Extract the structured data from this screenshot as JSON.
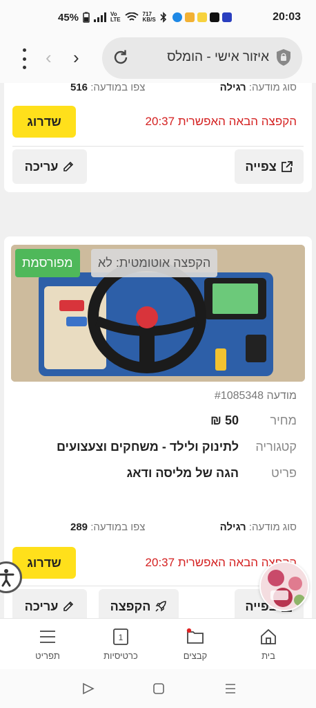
{
  "status_bar": {
    "battery": "45%",
    "network_speed_value": "717",
    "network_speed_unit": "KB/S",
    "time": "20:03"
  },
  "browser": {
    "url_title": "איזור אישי - הומלס"
  },
  "card1": {
    "ad_type_label": "סוג מודעה:",
    "ad_type_value": "רגילה",
    "views_label": "צפו במודעה:",
    "views_value": "516",
    "upgrade_label": "שדרוג",
    "next_bump": "הקפצה הבאה האפשרית 20:37",
    "view_label": "צפייה",
    "edit_label": "עריכה"
  },
  "card2": {
    "status_badge": "מפורסמת",
    "auto_bump_badge": "הקפצה אוטומטית: לא",
    "ad_number": "מודעה #1085348",
    "price_label": "מחיר",
    "price_value": "50 ₪",
    "category_label": "קטגוריה",
    "category_value": "לתינוק ולילד - משחקים וצעצועים",
    "item_label": "פריט",
    "item_value": "הגה של מליסה ודאג",
    "ad_type_label": "סוג מודעה:",
    "ad_type_value": "רגילה",
    "views_label": "צפו במודעה:",
    "views_value": "289",
    "upgrade_label": "שדרוג",
    "next_bump": "הקפצה הבאה האפשרית 20:37",
    "view_label": "צפייה",
    "bump_label": "הקפצה",
    "edit_label": "עריכה"
  },
  "bottom_nav": {
    "home": "בית",
    "folders": "קבצים",
    "cards_count": "1",
    "cards": "כרטיסיות",
    "menu": "תפריט"
  },
  "colors": {
    "accent_yellow": "#ffe01b",
    "published_green": "#4fb85a",
    "alert_red": "#d42020"
  }
}
